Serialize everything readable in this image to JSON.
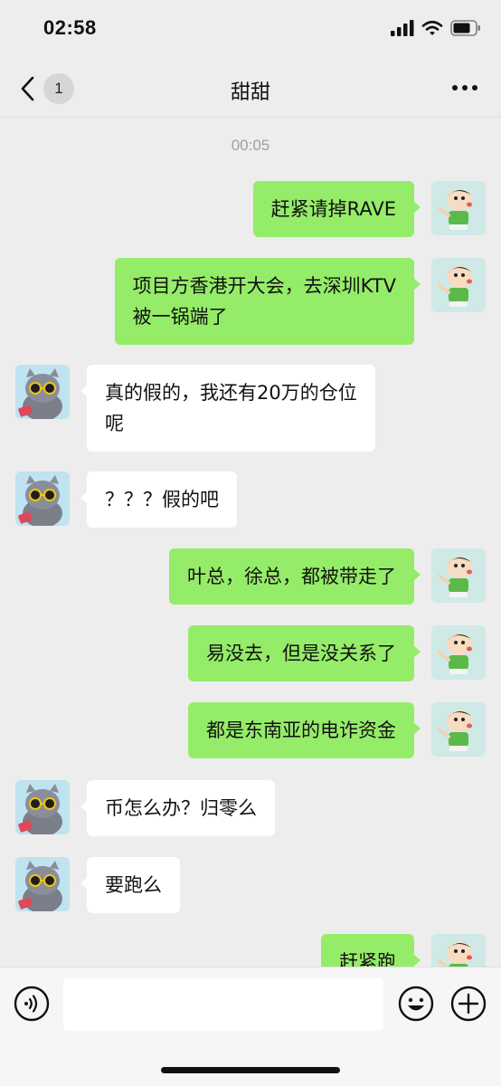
{
  "status_bar": {
    "time": "02:58"
  },
  "nav": {
    "back_badge": "1",
    "title": "甜甜"
  },
  "chat": {
    "timestamp": "00:05",
    "messages": [
      {
        "side": "out",
        "text": "赶紧请掉RAVE"
      },
      {
        "side": "out",
        "text": "项目方香港开大会，去深圳KTV\n被一锅端了"
      },
      {
        "side": "in",
        "text": "真的假的，我还有20万的仓位\n呢"
      },
      {
        "side": "in",
        "text": "？？？假的吧"
      },
      {
        "side": "out",
        "text": "叶总，徐总，都被带走了"
      },
      {
        "side": "out",
        "text": "易没去，但是没关系了"
      },
      {
        "side": "out",
        "text": "都是东南亚的电诈资金"
      },
      {
        "side": "in",
        "text": "币怎么办？归零么"
      },
      {
        "side": "in",
        "text": "要跑么"
      },
      {
        "side": "out",
        "text": "赶紧跑"
      }
    ]
  },
  "input_bar": {
    "placeholder": ""
  },
  "icons": {
    "back": "chevron-left-icon",
    "more": "more-dots-icon",
    "voice": "voice-icon",
    "emoji": "emoji-icon",
    "plus": "plus-icon"
  },
  "colors": {
    "background": "#ededed",
    "outgoing_bubble": "#95ec69",
    "incoming_bubble": "#ffffff",
    "timestamp": "#a0a0a0"
  }
}
